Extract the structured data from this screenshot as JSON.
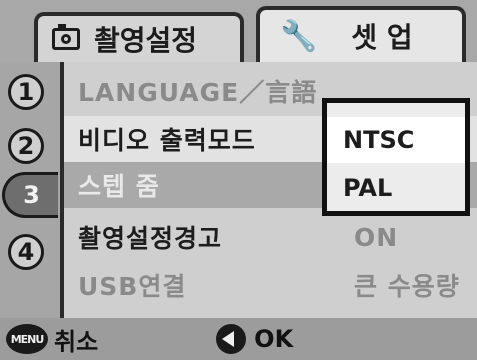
{
  "tabs": {
    "shoot": {
      "label": "촬영설정",
      "icon": "camera-icon"
    },
    "setup": {
      "label": "셋 업",
      "icon": "wrench-icon"
    }
  },
  "pages": [
    "1",
    "2",
    "3",
    "4"
  ],
  "active_page": "3",
  "menu": {
    "rows": [
      {
        "label": "LANGUAGE／言語",
        "value": ""
      },
      {
        "label": "비디오 출력모드",
        "value": ""
      },
      {
        "label": "스텝 줌",
        "value": ""
      },
      {
        "label": "촬영설정경고",
        "value": "ON"
      },
      {
        "label": "USB연결",
        "value": "큰 수용량"
      }
    ]
  },
  "popup": {
    "options": [
      "NTSC",
      "PAL"
    ],
    "selected": "NTSC"
  },
  "bottom": {
    "menu_button": "MENU",
    "cancel_label": "취소",
    "ok_label": "OK"
  },
  "colors": {
    "accent": "#111111",
    "panel": "#cfcfcf"
  }
}
